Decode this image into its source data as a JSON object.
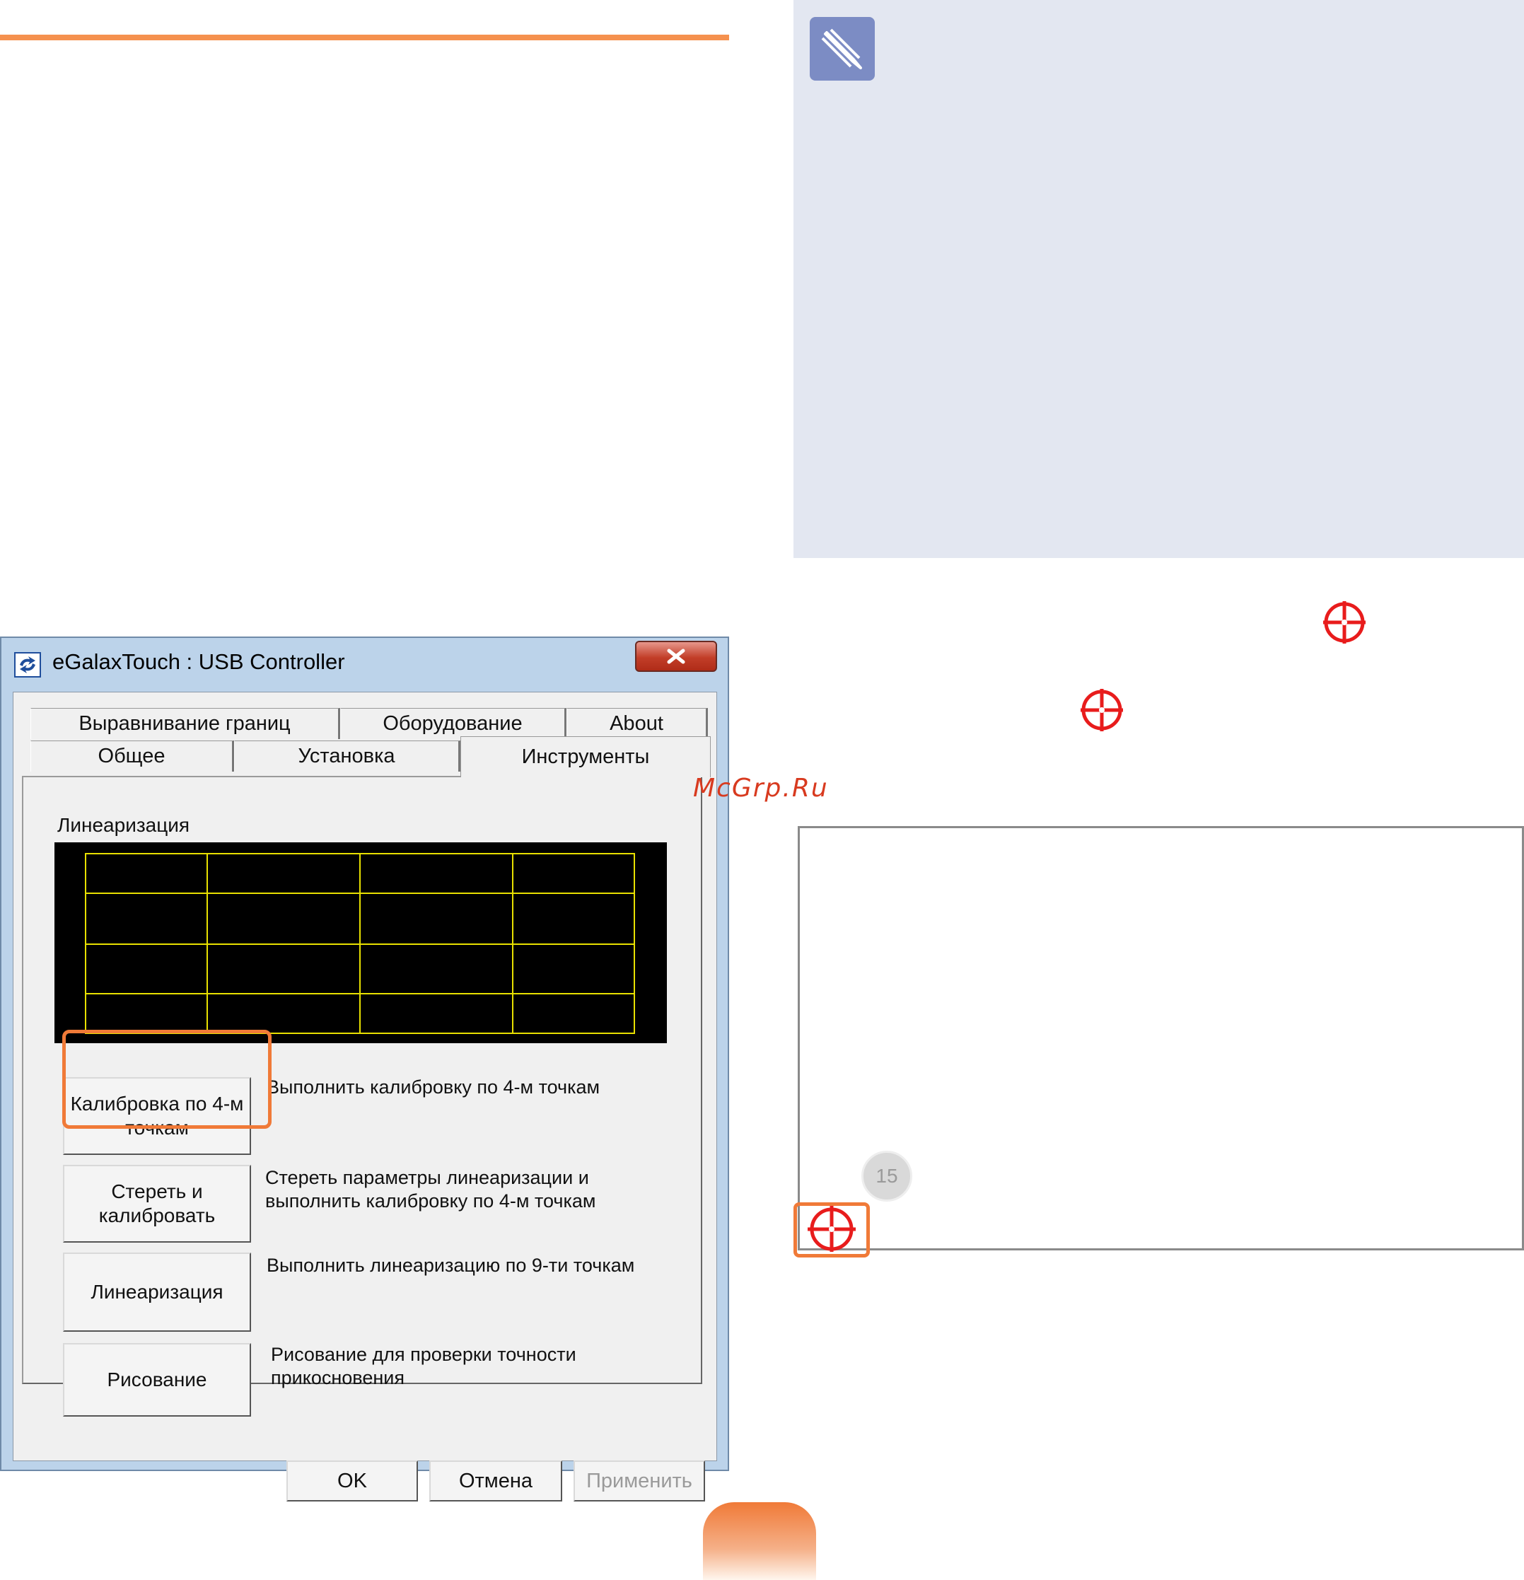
{
  "window": {
    "title": "eGalaxTouch : USB Controller"
  },
  "tabs": {
    "row_back": [
      {
        "label": "Выравнивание границ"
      },
      {
        "label": "Оборудование"
      },
      {
        "label": "About"
      }
    ],
    "row_front": [
      {
        "label": "Общее"
      },
      {
        "label": "Установка"
      },
      {
        "label": "Инструменты"
      }
    ],
    "active": "Инструменты"
  },
  "tools": {
    "group_label": "Линеаризация",
    "commands": [
      {
        "label": "Калибровка по 4-м точкам",
        "description": "Выполнить калибровку по 4-м точкам"
      },
      {
        "label": "Стереть и калибровать",
        "description": "Стереть параметры линеаризации и выполнить калибровку по 4-м точкам"
      },
      {
        "label": "Линеаризация",
        "description": "Выполнить линеаризацию по 9-ти точкам"
      },
      {
        "label": "Рисование",
        "description": "Рисование для проверки точности прикосновения"
      }
    ]
  },
  "buttons": {
    "ok": "OK",
    "cancel": "Отмена",
    "apply": "Применить"
  },
  "watermark": "McGrp.Ru",
  "calibration": {
    "countdown": "15"
  },
  "colors": {
    "accent": "#f07a38",
    "target": "#e81c1c",
    "grid": "#e8e000",
    "note_bg": "#e3e7f1"
  },
  "icons": {
    "note": "pencil-note-icon",
    "target": "crosshair-target-icon"
  }
}
